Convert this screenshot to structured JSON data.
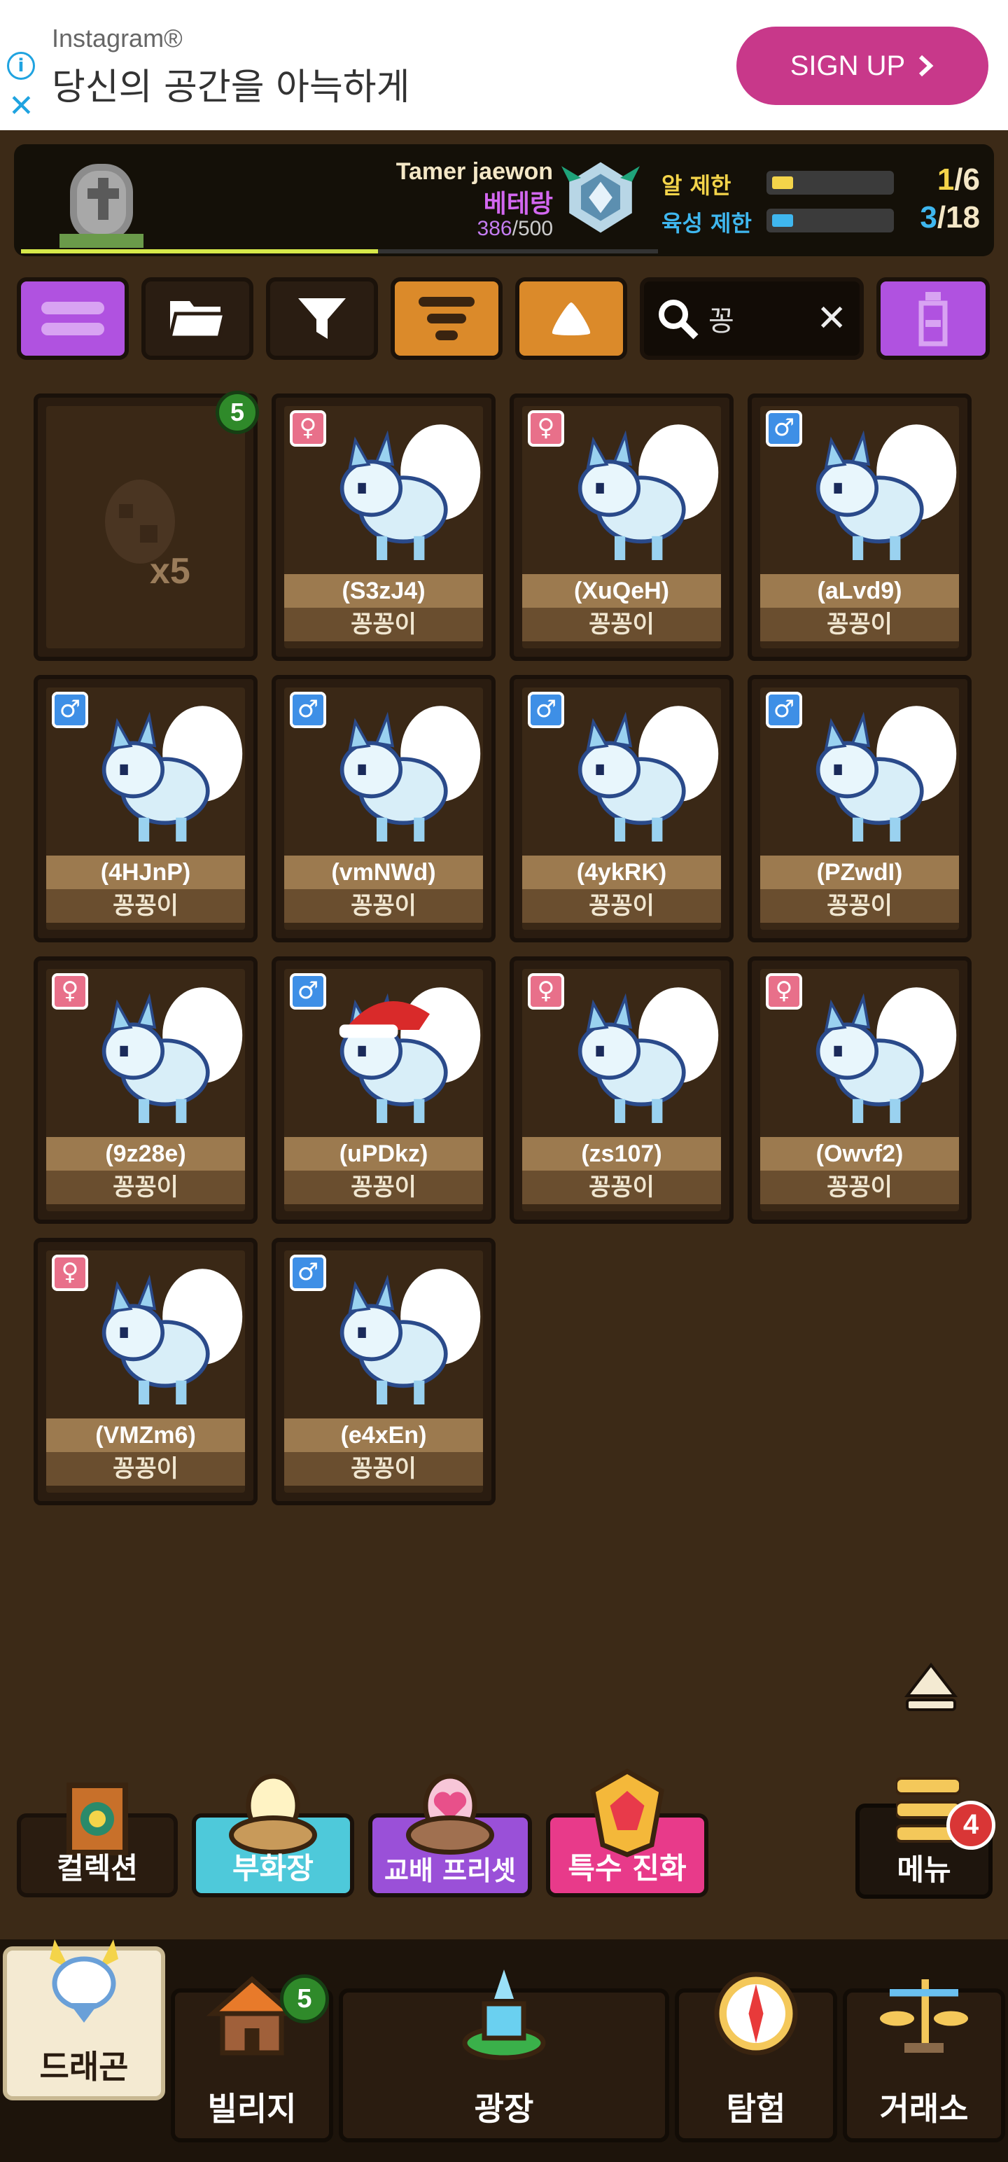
{
  "ad": {
    "source": "Instagram®",
    "headline": "당신의 공간을 아늑하게",
    "cta": "SIGN UP",
    "info_icon": "i",
    "close_icon": "✕"
  },
  "header": {
    "tamer": "Tamer jaewon",
    "species": "베테랑",
    "xp_current": "386",
    "xp_max": "/500",
    "xp_progress": 0.56,
    "egg_limit_label": "알 제한",
    "egg_count": "1",
    "egg_max": "/6",
    "breed_limit_label": "육성 제한",
    "breed_count": "3",
    "breed_max": "/18"
  },
  "toolbar": {
    "menu_icon": "list-icon",
    "folder_icon": "folder-icon",
    "filter_icon": "filter-icon",
    "sort_icon": "sort-icon",
    "order_icon": "triangle-up-icon",
    "search_query": "꽁",
    "clear": "✕",
    "bottle_icon": "bottle-icon"
  },
  "grid": {
    "egg_card": {
      "badge": "5",
      "qty": "x5"
    },
    "pets": [
      {
        "id": "(S3zJ4)",
        "species": "꽁꽁이",
        "gender": "♀",
        "g": "f"
      },
      {
        "id": "(XuQeH)",
        "species": "꽁꽁이",
        "gender": "♀",
        "g": "f"
      },
      {
        "id": "(aLvd9)",
        "species": "꽁꽁이",
        "gender": "♂",
        "g": "m"
      },
      {
        "id": "(4HJnP)",
        "species": "꽁꽁이",
        "gender": "♂",
        "g": "m"
      },
      {
        "id": "(vmNWd)",
        "species": "꽁꽁이",
        "gender": "♂",
        "g": "m"
      },
      {
        "id": "(4ykRK)",
        "species": "꽁꽁이",
        "gender": "♂",
        "g": "m"
      },
      {
        "id": "(PZwdI)",
        "species": "꽁꽁이",
        "gender": "♂",
        "g": "m"
      },
      {
        "id": "(9z28e)",
        "species": "꽁꽁이",
        "gender": "♀",
        "g": "f"
      },
      {
        "id": "(uPDkz)",
        "species": "꽁꽁이",
        "gender": "♂",
        "g": "m"
      },
      {
        "id": "(zs107)",
        "species": "꽁꽁이",
        "gender": "♀",
        "g": "f"
      },
      {
        "id": "(Owvf2)",
        "species": "꽁꽁이",
        "gender": "♀",
        "g": "f"
      },
      {
        "id": "(VMZm6)",
        "species": "꽁꽁이",
        "gender": "♀",
        "g": "f"
      },
      {
        "id": "(e4xEn)",
        "species": "꽁꽁이",
        "gender": "♂",
        "g": "m"
      }
    ]
  },
  "actions": {
    "collection": "컬렉션",
    "hatchery": "부화장",
    "breeding_preset": "교배 프리셋",
    "special_evolution": "특수 진화",
    "menu": "메뉴",
    "menu_badge": "4"
  },
  "nav": {
    "dragon": "드래곤",
    "village": "빌리지",
    "village_badge": "5",
    "plaza": "광장",
    "explore": "탐험",
    "exchange": "거래소"
  },
  "colors": {
    "background": "#3c2a17",
    "purple": "#b052e0",
    "orange": "#db8a2a",
    "female": "#e8708a",
    "male": "#3e8fe6",
    "ad_cta": "#c8388a"
  }
}
